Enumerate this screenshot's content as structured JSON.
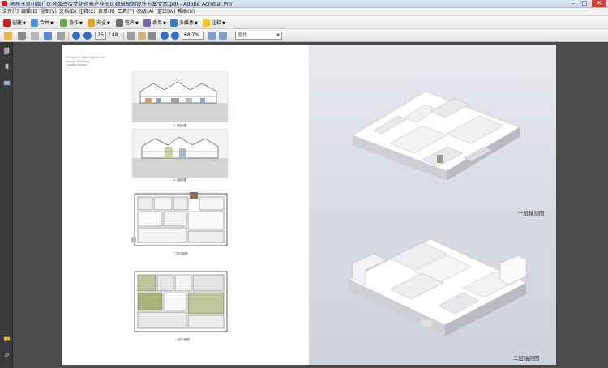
{
  "window": {
    "title": "杭州玉皇山南广区合库改造文化创意产业园区建筑规划设计方案文本.pdf - Adobe Acrobat Pro",
    "minimize": "–",
    "maximize": "□",
    "close": "✕"
  },
  "menu": [
    "文件(F)",
    "编辑(E)",
    "视图(V)",
    "文档(D)",
    "注释(C)",
    "表单(R)",
    "工具(T)",
    "高级(A)",
    "窗口(W)",
    "帮助(H)"
  ],
  "toolbar1": {
    "create": "创建",
    "combine": "合并",
    "collaborate": "协作",
    "secure": "安全",
    "sign": "签名",
    "forms": "表单",
    "multimedia": "多媒体",
    "comment": "注释"
  },
  "toolbar2": {
    "current_page": "26",
    "total_pages": "/ 48",
    "zoom": "68.7%",
    "find_placeholder": "查找"
  },
  "document": {
    "credit_lines": [
      "Hangzhou Yuhuangshan Nan",
      "Yuanjie Shehang",
      "Cangku Gaizao"
    ],
    "captions": {
      "section1": "1-1剖面图",
      "section2": "2-2剖面图",
      "plan2": "二层平面图",
      "plan1": "一层平面图"
    },
    "right_labels": {
      "axo1": "一层轴测图",
      "axo2": "二层轴测图"
    }
  },
  "colors": {
    "acrobat_red": "#c8211c",
    "doc_background": "#4b4b4b",
    "nav_background": "#3a3a3a"
  }
}
